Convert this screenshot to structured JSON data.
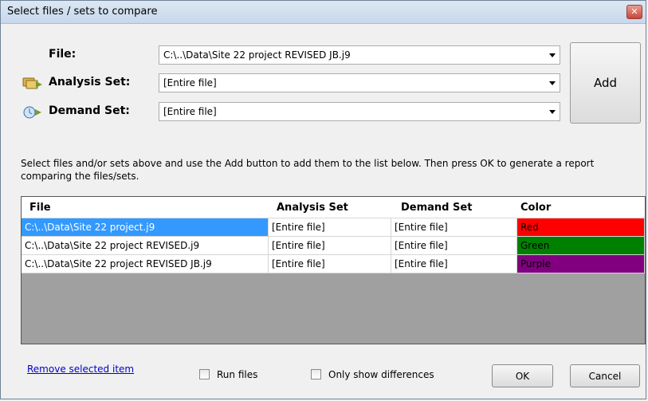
{
  "window": {
    "title": "Select files / sets to compare"
  },
  "form": {
    "file_label": "File:",
    "file_value": "C:\\..\\Data\\Site 22 project REVISED JB.j9",
    "analysis_label": "Analysis Set:",
    "analysis_value": "[Entire file]",
    "demand_label": "Demand Set:",
    "demand_value": "[Entire file]",
    "add_label": "Add",
    "icons": {
      "analysis": "analysis-set-icon",
      "demand": "demand-set-icon"
    }
  },
  "hint": "Select files and/or sets above and use the Add button to add them to the list below.  Then press OK to generate a report comparing the files/sets.",
  "list": {
    "headers": [
      "File",
      "Analysis Set",
      "Demand Set",
      "Color"
    ],
    "rows": [
      {
        "file": "C:\\..\\Data\\Site 22 project.j9",
        "analysis": "[Entire file]",
        "demand": "[Entire file]",
        "color": "Red",
        "color_hex": "#ff0000"
      },
      {
        "file": "C:\\..\\Data\\Site 22 project REVISED.j9",
        "analysis": "[Entire file]",
        "demand": "[Entire file]",
        "color": "Green",
        "color_hex": "#008000"
      },
      {
        "file": "C:\\..\\Data\\Site 22 project REVISED JB.j9",
        "analysis": "[Entire file]",
        "demand": "[Entire file]",
        "color": "Purple",
        "color_hex": "#800080"
      }
    ]
  },
  "footer": {
    "remove_label": "Remove selected item",
    "run_files_label": "Run files",
    "only_diff_label": "Only show differences",
    "ok_label": "OK",
    "cancel_label": "Cancel"
  },
  "colors": {
    "selection": "#3399ff",
    "list_background": "#a0a0a0"
  }
}
